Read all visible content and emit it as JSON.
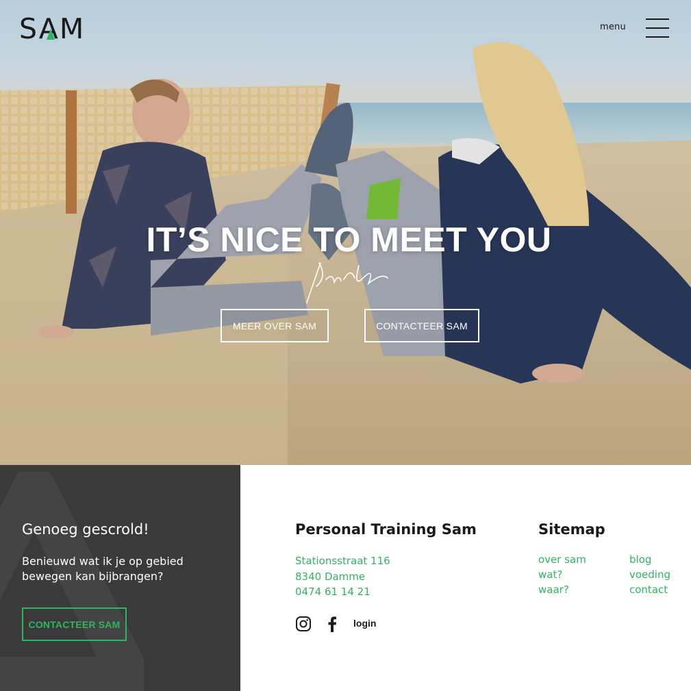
{
  "header": {
    "logo_text": "SAM",
    "menu_label": "menu",
    "icons": [
      "logo",
      "hamburger-icon"
    ]
  },
  "hero": {
    "headline": "IT’S NICE TO MEET YOU",
    "signature_text": "John Doe",
    "buttons": {
      "about_label": "MEER OVER SAM",
      "contact_label": "CONTACTEER SAM"
    }
  },
  "footer_cta": {
    "title": "Genoeg gescrold!",
    "text": "Benieuwd wat ik je op gebied bewegen kan bijbrangen?",
    "button_label": "CONTACTEER SAM"
  },
  "footer_contact": {
    "title": "Personal Training Sam",
    "address": [
      "Stationsstraat 116",
      "8340 Damme",
      "0474 61 14 21"
    ],
    "social_icons": [
      "instagram-icon",
      "facebook-icon"
    ],
    "login_label": "login"
  },
  "sitemap": {
    "title": "Sitemap",
    "col1": [
      "over sam",
      "wat?",
      "waar?"
    ],
    "col2": [
      "blog",
      "voeding",
      "contact"
    ]
  },
  "colors": {
    "accent_green": "#2fb560",
    "dark_panel": "#3a3a3a",
    "text_dark": "#1a1a1a",
    "white": "#ffffff"
  }
}
